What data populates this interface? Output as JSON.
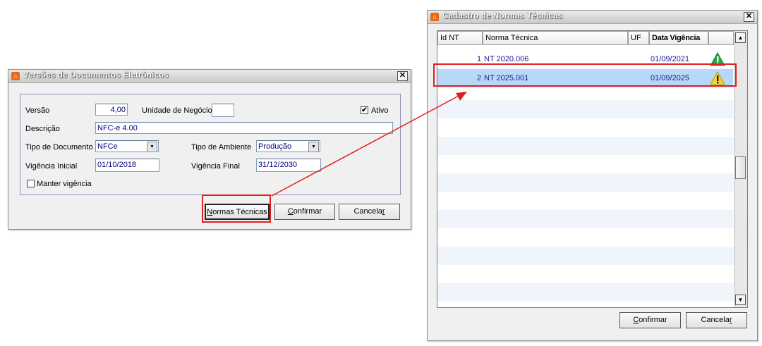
{
  "versoes": {
    "title": "Versões de Documentos Eletrônicos",
    "versao_label": "Versão",
    "versao_value": "4,00",
    "unidade_label": "Unidade de Negócio",
    "unidade_value": "",
    "ativo_label": "Ativo",
    "ativo_checked": "✔",
    "descricao_label": "Descrição",
    "descricao_value": "NFC-e 4.00",
    "tipo_doc_label": "Tipo de Documento",
    "tipo_doc_value": "NFCe",
    "tipo_amb_label": "Tipo de Ambiente",
    "tipo_amb_value": "Produção",
    "vig_ini_label": "Vigência Inicial",
    "vig_ini_value": "01/10/2018",
    "vig_fin_label": "Vigência Final",
    "vig_fin_value": "31/12/2030",
    "manter_label": "Manter vigência",
    "btn_normas_hot": "N",
    "btn_normas_rest": "ormas Técnicas",
    "btn_confirmar_hot": "C",
    "btn_confirmar_rest": "onfirmar",
    "btn_cancelar_pre": "Cancela",
    "btn_cancelar_hot": "r"
  },
  "normas": {
    "title": "Cadastro de Normas Técnicas",
    "columns": [
      "Id NT",
      "Norma Técnica",
      "UF",
      "Data Vigência"
    ],
    "rows": [
      {
        "id": "1",
        "norma": "NT 2020.006",
        "uf": "",
        "data": "01/09/2021",
        "status_icon": "ok-triangle-icon"
      },
      {
        "id": "2",
        "norma": "NT 2025.001",
        "uf": "",
        "data": "01/09/2025",
        "status_icon": "warning-triangle-icon"
      }
    ],
    "btn_confirmar_hot": "C",
    "btn_confirmar_rest": "onfirmar",
    "btn_cancelar_pre": "Cancela",
    "btn_cancelar_hot": "r"
  },
  "colors": {
    "highlight": "#e02020",
    "selected_row": "#b8d8f8",
    "ok_icon": "#29a84a",
    "warn_icon": "#f7d12a"
  }
}
